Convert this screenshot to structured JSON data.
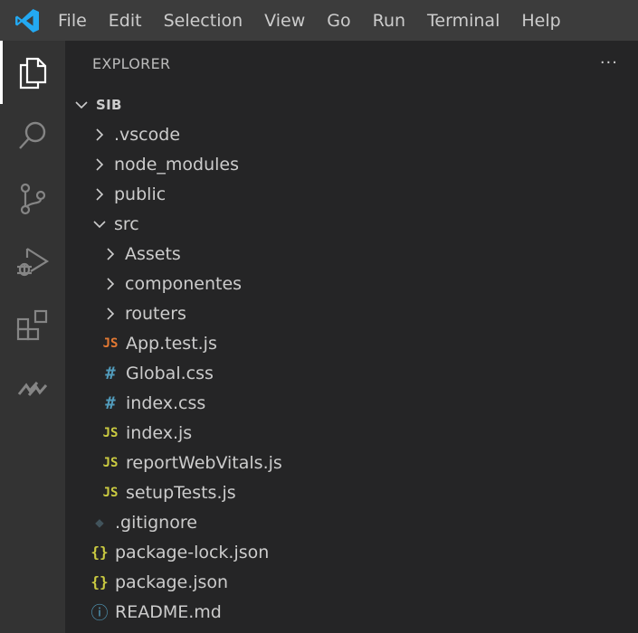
{
  "menu": [
    "File",
    "Edit",
    "Selection",
    "View",
    "Go",
    "Run",
    "Terminal",
    "Help"
  ],
  "activity_bar": {
    "items": [
      {
        "icon": "explorer-icon",
        "active": true
      },
      {
        "icon": "search-icon",
        "active": false
      },
      {
        "icon": "source-control-icon",
        "active": false
      },
      {
        "icon": "run-debug-icon",
        "active": false
      },
      {
        "icon": "extensions-icon",
        "active": false
      },
      {
        "icon": "live-share-icon",
        "active": false
      }
    ]
  },
  "sidebar": {
    "title": "EXPLORER",
    "more": "···",
    "root": "SIB",
    "items": [
      {
        "name": ".vscode",
        "type": "folder",
        "expanded": false,
        "depth": 1
      },
      {
        "name": "node_modules",
        "type": "folder",
        "expanded": false,
        "depth": 1
      },
      {
        "name": "public",
        "type": "folder",
        "expanded": false,
        "depth": 1
      },
      {
        "name": "src",
        "type": "folder",
        "expanded": true,
        "depth": 1
      },
      {
        "name": "Assets",
        "type": "folder",
        "expanded": false,
        "depth": 2
      },
      {
        "name": "componentes",
        "type": "folder",
        "expanded": false,
        "depth": 2
      },
      {
        "name": "routers",
        "type": "folder",
        "expanded": false,
        "depth": 2
      },
      {
        "name": "App.test.js",
        "type": "jstest",
        "glyph": "JS",
        "depth": 2
      },
      {
        "name": "Global.css",
        "type": "css",
        "glyph": "#",
        "depth": 2
      },
      {
        "name": "index.css",
        "type": "css",
        "glyph": "#",
        "depth": 2
      },
      {
        "name": "index.js",
        "type": "js",
        "glyph": "JS",
        "depth": 2
      },
      {
        "name": "reportWebVitals.js",
        "type": "js",
        "glyph": "JS",
        "depth": 2
      },
      {
        "name": "setupTests.js",
        "type": "js",
        "glyph": "JS",
        "depth": 2
      },
      {
        "name": ".gitignore",
        "type": "git",
        "glyph": "◆",
        "depth": 1
      },
      {
        "name": "package-lock.json",
        "type": "json",
        "glyph": "{}",
        "depth": 1
      },
      {
        "name": "package.json",
        "type": "json",
        "glyph": "{}",
        "depth": 1
      },
      {
        "name": "README.md",
        "type": "info",
        "glyph": "ⓘ",
        "depth": 1
      }
    ]
  },
  "colors": {
    "menubar": "#3c3c3c",
    "activitybar": "#333333",
    "sidebar": "#252526",
    "vscode_blue": "#23a9f2",
    "js": "#cbcb41",
    "jstest": "#e37933",
    "css": "#519aba"
  }
}
